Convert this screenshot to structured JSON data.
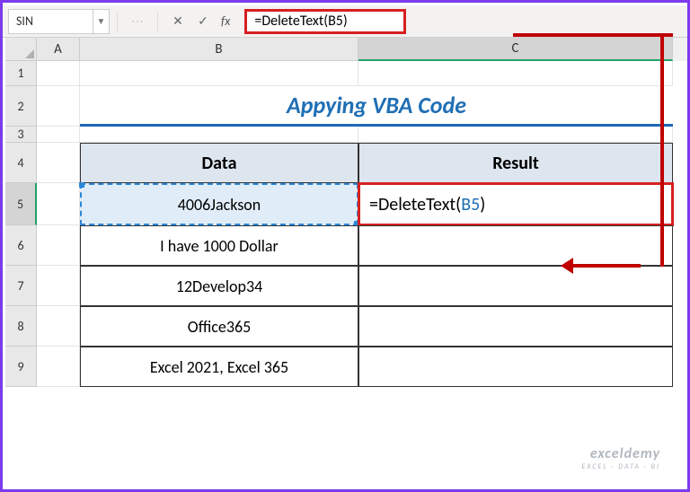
{
  "name_box": "SIN",
  "formula_bar": {
    "fx": "fx",
    "text": "=DeleteText(B5)"
  },
  "columns": {
    "a": "A",
    "b": "B",
    "c": "C"
  },
  "row_labels": [
    "1",
    "2",
    "3",
    "4",
    "5",
    "6",
    "7",
    "8",
    "9"
  ],
  "title": "Appying VBA Code",
  "headers": {
    "data": "Data",
    "result": "Result"
  },
  "rows_data": {
    "r5": "4006Jackson",
    "r6": "I have 1000 Dollar",
    "r7": "12Develop34",
    "r8": "Office365",
    "r9": "Excel 2021, Excel 365"
  },
  "c5_prefix": "=DeleteText(",
  "c5_ref": "B5",
  "c5_suffix": ")",
  "watermark": {
    "main": "exceldemy",
    "sub": "EXCEL · DATA · BI"
  }
}
